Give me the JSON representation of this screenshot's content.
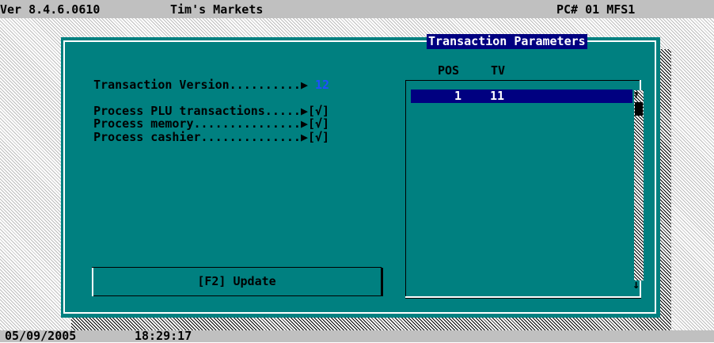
{
  "header": {
    "version": "Ver 8.4.6.0610",
    "store_name": "Tim's Markets",
    "pc_info": "PC# 01 MFS1"
  },
  "dialog": {
    "title": "Transaction Parameters",
    "fields": [
      {
        "label": "Transaction Version..........▶",
        "value": "12"
      },
      {
        "label": "Process PLU transactions.....▶",
        "value": "[√]"
      },
      {
        "label": "Process memory...............▶",
        "value": "[√]"
      },
      {
        "label": "Process cashier..............▶",
        "value": "[√]"
      }
    ],
    "update_button": "[F2] Update",
    "list": {
      "headers": [
        "POS",
        "TV"
      ],
      "rows": [
        {
          "pos": "1",
          "tv": "11"
        }
      ],
      "scroll_up": "↑",
      "scroll_down": "↓"
    }
  },
  "status": {
    "date": "05/09/2005",
    "time": "18:29:17"
  },
  "colors": {
    "dialog_bg": "#008080",
    "title_bg": "#000080",
    "value_accent": "#1e4fff",
    "bar_bg": "#c0c0c0"
  }
}
